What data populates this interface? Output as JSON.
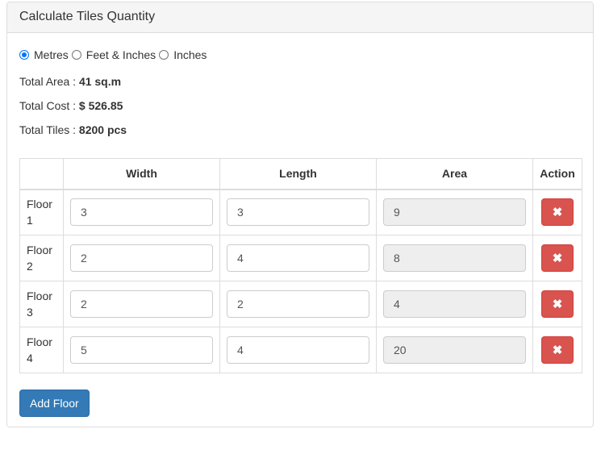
{
  "panel": {
    "title": "Calculate Tiles Quantity"
  },
  "units": {
    "options": [
      {
        "label": "Metres",
        "checked": true
      },
      {
        "label": "Feet & Inches",
        "checked": false
      },
      {
        "label": "Inches",
        "checked": false
      }
    ]
  },
  "totals": {
    "area_label": "Total Area :",
    "area_value": "41 sq.m",
    "cost_label": "Total Cost :",
    "cost_value": "$ 526.85",
    "tiles_label": "Total Tiles :",
    "tiles_value": "8200 pcs"
  },
  "table": {
    "headers": [
      "",
      "Width",
      "Length",
      "Area",
      "Action"
    ],
    "rows": [
      {
        "floor": "Floor 1",
        "width": "3",
        "length": "3",
        "area": "9",
        "action_icon": "times-icon"
      },
      {
        "floor": "Floor 2",
        "width": "2",
        "length": "4",
        "area": "8",
        "action_icon": "times-icon"
      },
      {
        "floor": "Floor 3",
        "width": "2",
        "length": "2",
        "area": "4",
        "action_icon": "times-icon"
      },
      {
        "floor": "Floor 4",
        "width": "5",
        "length": "4",
        "area": "20",
        "action_icon": "times-icon"
      }
    ]
  },
  "buttons": {
    "add_floor": "Add Floor"
  },
  "colors": {
    "primary": "#337ab7",
    "danger": "#d9534f",
    "radio_accent": "#0075ff"
  }
}
